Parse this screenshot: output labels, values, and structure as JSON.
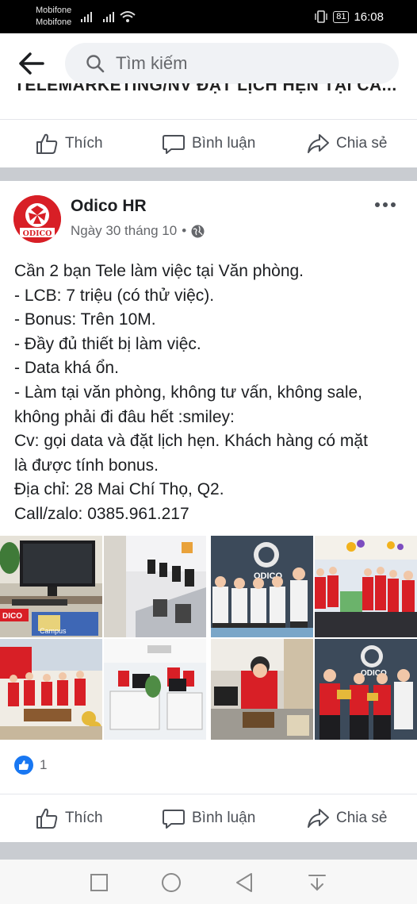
{
  "status_bar": {
    "carrier_1": "Mobifone",
    "carrier_2": "Mobifone",
    "battery": "81",
    "time": "16:08"
  },
  "search": {
    "placeholder": "Tìm kiếm"
  },
  "previous_post": {
    "clipped_title": "TELEMARKETING/NV ĐẶT LỊCH HẸN TẠI CÁ..."
  },
  "actions": {
    "like": "Thích",
    "comment": "Bình luận",
    "share": "Chia sẻ"
  },
  "post": {
    "author": "Odico HR",
    "avatar_text": "ODICO",
    "date": "Ngày 30 tháng 10",
    "separator": "•",
    "privacy_icon": "globe-icon",
    "lines": [
      "Cần 2 bạn Tele làm việc tại Văn phòng.",
      "- LCB: 7 triệu (có thử việc).",
      "- Bonus: Trên 10M.",
      "- Đầy đủ thiết bị làm việc.",
      "- Data khá ổn.",
      "- Làm tại văn phòng, không tư vấn, không sale,",
      "không phải đi đâu hết :smiley:",
      "Cv: gọi data và đặt lịch hẹn. Khách hàng có mặt",
      "là được tính bonus.",
      "Địa chỉ: 28 Mai Chí Thọ, Q2.",
      "Call/zalo: 0385.961.217"
    ],
    "photo_labels": {
      "odico_sign": "DICO",
      "campus": "Campus",
      "wall_logo": "ODICO",
      "wall_logo_2": "ODICO"
    },
    "reaction_count": "1"
  },
  "colors": {
    "accent": "#1877f2",
    "brand_red": "#d81f26",
    "divider": "#c9ccd1"
  }
}
